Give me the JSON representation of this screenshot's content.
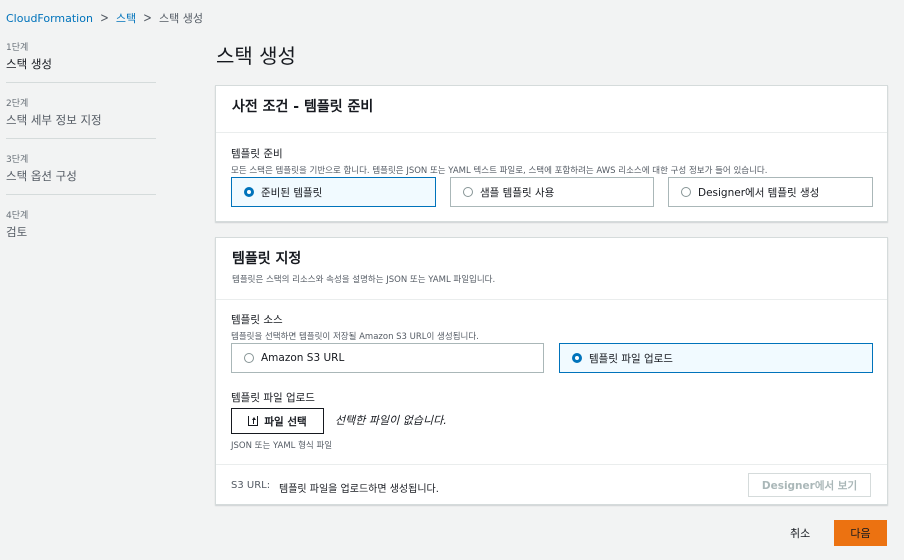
{
  "breadcrumb": {
    "item1": "CloudFormation",
    "item2": "스택",
    "current": "스택 생성"
  },
  "steps": [
    {
      "num": "1단계",
      "label": "스택 생성"
    },
    {
      "num": "2단계",
      "label": "스택 세부 정보 지정"
    },
    {
      "num": "3단계",
      "label": "스택 옵션 구성"
    },
    {
      "num": "4단계",
      "label": "검토"
    }
  ],
  "page_title": "스택 생성",
  "prereq": {
    "title": "사전 조건 - 템플릿 준비",
    "field_label": "템플릿 준비",
    "field_desc": "모든 스택은 템플릿을 기반으로 합니다. 템플릿은 JSON 또는 YAML 텍스트 파일로, 스택에 포함하려는 AWS 리소스에 대한 구성 정보가 들어 있습니다.",
    "options": [
      {
        "label": "준비된 템플릿",
        "selected": true
      },
      {
        "label": "샘플 템플릿 사용",
        "selected": false
      },
      {
        "label": "Designer에서 템플릿 생성",
        "selected": false
      }
    ]
  },
  "template": {
    "title": "템플릿 지정",
    "desc": "템플릿은 스택의 리소스와 속성을 설명하는 JSON 또는 YAML 파일입니다.",
    "source_label": "템플릿 소스",
    "source_desc": "템플릿을 선택하면 템플릿이 저장될 Amazon S3 URL이 생성됩니다.",
    "sources": [
      {
        "label": "Amazon S3 URL",
        "selected": false
      },
      {
        "label": "템플릿 파일 업로드",
        "selected": true
      }
    ],
    "upload_label": "템플릿 파일 업로드",
    "choose_file": "파일 선택",
    "no_file": "선택한 파일이 없습니다.",
    "format_hint": "JSON 또는 YAML 형식 파일",
    "s3_url_label": "S3 URL:",
    "s3_url_value": "템플릿 파일을 업로드하면 생성됩니다.",
    "view_designer": "Designer에서 보기"
  },
  "footer": {
    "cancel": "취소",
    "next": "다음"
  },
  "colors": {
    "accent": "#0073bb",
    "primary_button": "#ec7211"
  },
  "icons": {
    "breadcrumb_separator": "chevron-right-icon",
    "upload": "upload-icon"
  }
}
